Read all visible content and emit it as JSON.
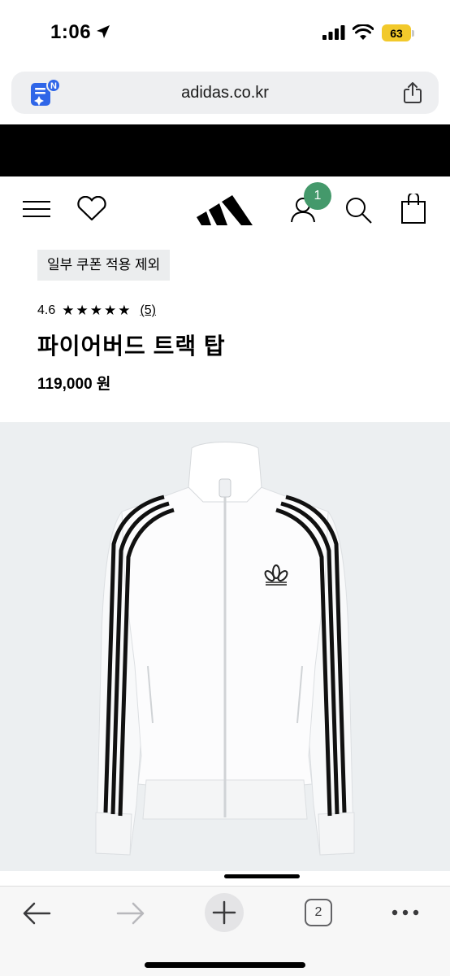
{
  "status_bar": {
    "time": "1:06",
    "battery": "63",
    "icons": [
      "location-arrow-icon",
      "cellular-signal-icon",
      "wifi-icon",
      "battery-icon"
    ]
  },
  "browser": {
    "url": "adidas.co.kr",
    "extension_badge": "N",
    "tab_count": "2"
  },
  "header": {
    "cart_badge": "1",
    "icons": [
      "menu-icon",
      "heart-icon",
      "adidas-logo",
      "account-icon",
      "search-icon",
      "bag-icon"
    ]
  },
  "product": {
    "coupon_tag": "일부 쿠폰 적용 제외",
    "rating_score": "4.6",
    "rating_stars": "★★★★★",
    "review_count": "(5)",
    "title": "파이어버드 트랙 탑",
    "price": "119,000 원"
  },
  "colors": {
    "badge_green": "#44996b",
    "battery_yellow": "#f2c92b",
    "image_bg": "#eceff1",
    "tag_bg": "#ebedee"
  }
}
